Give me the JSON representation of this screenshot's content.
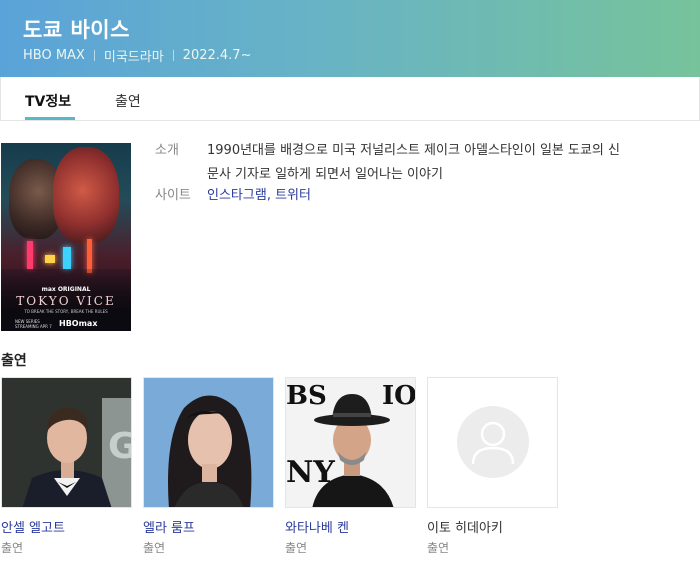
{
  "header": {
    "title": "도쿄 바이스",
    "network": "HBO MAX",
    "genre": "미국드라마",
    "date": "2022.4.7~"
  },
  "tabs": [
    {
      "label": "TV정보",
      "active": true
    },
    {
      "label": "출연",
      "active": false
    }
  ],
  "poster": {
    "line1": "max ORIGINAL",
    "line2": "TOKYO VICE",
    "line3": "TO BREAK THE STORY, BREAK THE RULES",
    "line4": "HBOmax",
    "line5": "NEW SERIES STREAMING APR 7"
  },
  "info": {
    "intro_label": "소개",
    "intro_text_line1": "1990년대를 배경으로 미국 저널리스트 제이크 아델스타인이 일본 도쿄의 신",
    "intro_text_line2": "문사 기자로 일하게 되면서 일어나는 이야기",
    "site_label": "사이트",
    "site_links": [
      "인스타그램",
      "트위터"
    ],
    "site_separator": ", "
  },
  "cast_section": {
    "title": "출연",
    "members": [
      {
        "name": "안셀 엘고트",
        "role": "출연",
        "linked": true
      },
      {
        "name": "엘라 룸프",
        "role": "출연",
        "linked": true
      },
      {
        "name": "와타나베 켄",
        "role": "출연",
        "linked": true
      },
      {
        "name": "이토 히데아키",
        "role": "출연",
        "linked": false
      }
    ]
  },
  "colors": {
    "header_gradient_start": "#5aa3d9",
    "header_gradient_end": "#76c39b",
    "tab_underline": "#5ab8c6",
    "link": "#2a3a9c"
  }
}
